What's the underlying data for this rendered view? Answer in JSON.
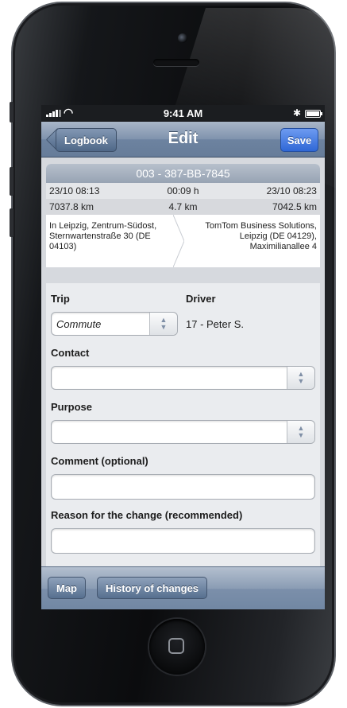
{
  "status_bar": {
    "time": "9:41 AM"
  },
  "nav": {
    "back_label": "Logbook",
    "title": "Edit",
    "save_label": "Save"
  },
  "trip": {
    "plate": "003 - 387-BB-7845",
    "start_time": "23/10 08:13",
    "duration": "00:09 h",
    "end_time": "23/10 08:23",
    "start_km": "7037.8 km",
    "distance": "4.7 km",
    "end_km": "7042.5 km",
    "from_address": "In Leipzig, Zentrum-Südost, Sternwartenstraße 30 (DE 04103)",
    "to_address": "TomTom Business Solutions, Leipzig (DE 04129), Maximilianallee 4"
  },
  "form": {
    "trip_label": "Trip",
    "trip_value": "Commute",
    "driver_label": "Driver",
    "driver_value": "17 - Peter S.",
    "contact_label": "Contact",
    "contact_value": "",
    "purpose_label": "Purpose",
    "purpose_value": "",
    "comment_label": "Comment (optional)",
    "comment_value": "",
    "reason_label": "Reason for the change (recommended)",
    "reason_value": ""
  },
  "toolbar": {
    "map_label": "Map",
    "history_label": "History of changes"
  },
  "colors": {
    "nav_bar": "#7f93ad",
    "save_button": "#2f67d6",
    "plate_header": "#a6b0be"
  }
}
